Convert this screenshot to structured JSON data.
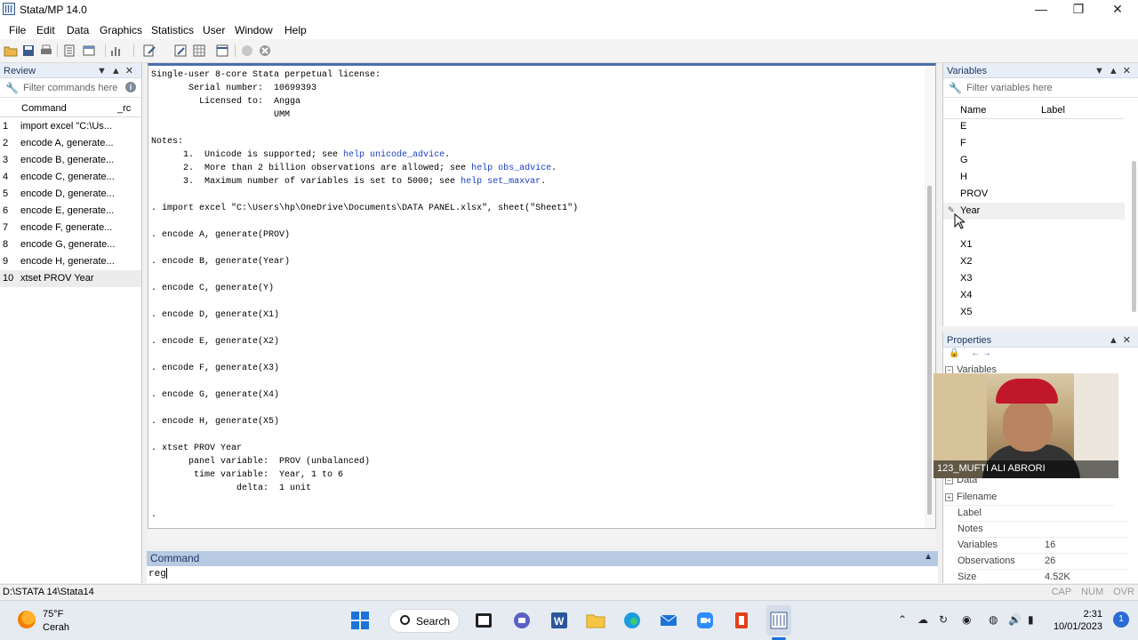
{
  "window": {
    "title": "Stata/MP 14.0"
  },
  "menu": [
    "File",
    "Edit",
    "Data",
    "Graphics",
    "Statistics",
    "User",
    "Window",
    "Help"
  ],
  "review": {
    "title": "Review",
    "filter_placeholder": "Filter commands here",
    "col_command": "Command",
    "col_rc": "_rc",
    "items": [
      {
        "num": "1",
        "cmd": "import excel \"C:\\Us..."
      },
      {
        "num": "2",
        "cmd": "encode A, generate..."
      },
      {
        "num": "3",
        "cmd": "encode B, generate..."
      },
      {
        "num": "4",
        "cmd": "encode C, generate..."
      },
      {
        "num": "5",
        "cmd": "encode D, generate..."
      },
      {
        "num": "6",
        "cmd": "encode E, generate..."
      },
      {
        "num": "7",
        "cmd": "encode F, generate..."
      },
      {
        "num": "8",
        "cmd": "encode G, generate..."
      },
      {
        "num": "9",
        "cmd": "encode H, generate..."
      },
      {
        "num": "10",
        "cmd": "xtset PROV Year"
      }
    ]
  },
  "results": {
    "l1": "Single-user 8-core Stata perpetual license:",
    "l2": "       Serial number:  10699393",
    "l3": "         Licensed to:  Angga",
    "l4": "                       UMM",
    "l5": "",
    "l6": "Notes:",
    "l7a": "      1.  Unicode is supported; see ",
    "l7link": "help unicode_advice",
    "l7b": ".",
    "l8a": "      2.  More than 2 billion observations are allowed; see ",
    "l8link": "help obs_advice",
    "l8b": ".",
    "l9a": "      3.  Maximum number of variables is set to 5000; see ",
    "l9link": "help set_maxvar",
    "l9b": ".",
    "l10": "",
    "l11": ". import excel \"C:\\Users\\hp\\OneDrive\\Documents\\DATA PANEL.xlsx\", sheet(\"Sheet1\")",
    "l12": "",
    "l13": ". encode A, generate(PROV)",
    "l14": "",
    "l15": ". encode B, generate(Year)",
    "l16": "",
    "l17": ". encode C, generate(Y)",
    "l18": "",
    "l19": ". encode D, generate(X1)",
    "l20": "",
    "l21": ". encode E, generate(X2)",
    "l22": "",
    "l23": ". encode F, generate(X3)",
    "l24": "",
    "l25": ". encode G, generate(X4)",
    "l26": "",
    "l27": ". encode H, generate(X5)",
    "l28": "",
    "l29": ". xtset PROV Year",
    "l30": "       panel variable:  PROV (unbalanced)",
    "l31": "        time variable:  Year, 1 to 6",
    "l32": "                delta:  1 unit",
    "l33": "",
    "l34": "."
  },
  "command": {
    "title": "Command",
    "value": "reg"
  },
  "variables": {
    "title": "Variables",
    "filter_placeholder": "Filter variables here",
    "col_name": "Name",
    "col_label": "Label",
    "items": [
      "E",
      "F",
      "G",
      "H",
      "PROV",
      "Year",
      "",
      "X1",
      "X2",
      "X3",
      "X4",
      "X5"
    ]
  },
  "properties": {
    "title": "Properties",
    "sec_variables": "Variables",
    "sec_data": "Data",
    "rows": [
      {
        "k": "Filename",
        "v": ""
      },
      {
        "k": "Label",
        "v": ""
      },
      {
        "k": "Notes",
        "v": ""
      },
      {
        "k": "Variables",
        "v": "16"
      },
      {
        "k": "Observations",
        "v": "26"
      },
      {
        "k": "Size",
        "v": "4.52K"
      }
    ]
  },
  "webcam": {
    "name": "123_MUFTI ALI ABRORI"
  },
  "status": {
    "path": "D:\\STATA 14\\Stata14",
    "keys": "CAP NUM OVR"
  },
  "taskbar": {
    "temp": "75°F",
    "weather": "Cerah",
    "search": "Search",
    "time": "2:31",
    "date": "10/01/2023",
    "notifications": "1"
  },
  "colors": {
    "accent": "#4a6ea8",
    "link": "#1c3fc4",
    "header": "#e8eef7"
  }
}
